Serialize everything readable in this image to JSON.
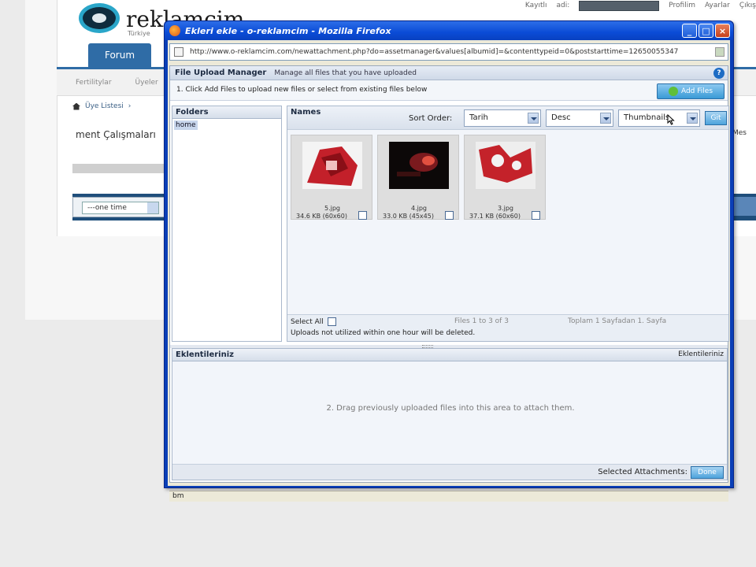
{
  "background": {
    "logo_text": "reklamcim",
    "logo_sub": "Türkiye",
    "top_links": [
      "Kayıtlı",
      "adi:",
      "Profilim",
      "Ayarlar",
      "Çıkış"
    ],
    "nav_tab": "Forum",
    "subnav": [
      "Fertilitylar",
      "Üyeler"
    ],
    "breadcrumb": [
      "Üye Listesi",
      "›"
    ],
    "page_heading": "ment Çalışmaları",
    "select_value": "---one time",
    "right_fragment": "Mes"
  },
  "window": {
    "title": "Ekleri ekle - o-reklamcim - Mozilla Firefox",
    "url": "http://www.o-reklamcim.com/newattachment.php?do=assetmanager&values[albumid]=&contenttypeid=0&poststarttime=12650055347",
    "status_text": "bm"
  },
  "manager": {
    "title": "File Upload Manager",
    "subtitle": "Manage all files that you have uploaded",
    "instruction": "1. Click Add Files to upload new files or select from existing files below",
    "add_files_label": "Add Files",
    "folders_label": "Folders",
    "folder_home": "home",
    "names_label": "Names",
    "sort_label": "Sort Order:",
    "sort_field": "Tarih",
    "sort_dir": "Desc",
    "view_mode": "Thumbnails",
    "go_label": "Git",
    "files": [
      {
        "name": "5.jpg",
        "size": "34.6 KB (60x60)"
      },
      {
        "name": "4.jpg",
        "size": "33.0 KB (45x45)"
      },
      {
        "name": "3.jpg",
        "size": "37.1 KB (60x60)"
      }
    ],
    "select_all": "Select All",
    "files_count": "Files 1 to 3 of 3",
    "pager": "Toplam 1 Sayfadan 1. Sayfa",
    "foot_note": "Uploads not utilized within one hour will be deleted.",
    "attachments_label": "Eklentileriniz",
    "attachments_right": "Eklentileriniz",
    "drag_text": "2. Drag previously uploaded files into this area to attach them.",
    "selected_attachments": "Selected Attachments:",
    "done_label": "Done"
  },
  "colors": {
    "titlebar": "#0a4bd6",
    "accent": "#3a9ad6"
  }
}
